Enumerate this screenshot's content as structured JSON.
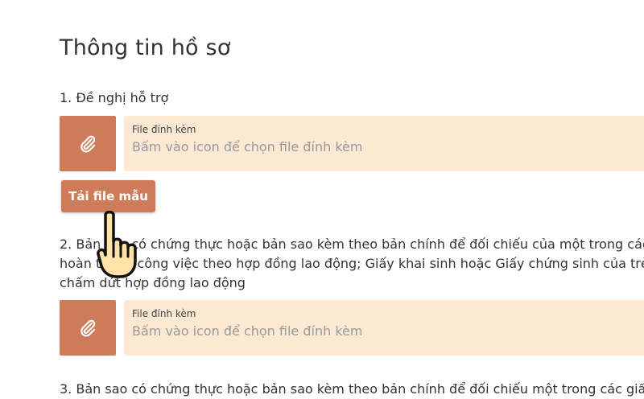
{
  "page": {
    "title": "Thông tin hồ sơ"
  },
  "sections": [
    {
      "label": "1. Đề nghị hỗ trợ",
      "attachment": {
        "label": "File đính kèm",
        "placeholder": "Bấm vào icon để chọn file đính kèm"
      },
      "sample_button": "Tải file mẫu"
    },
    {
      "label_lines": [
        "2. Bản sao có chứng thực hoặc bản sao kèm theo bản chính để đối chiếu của một trong các",
        "hoàn thành công việc theo hợp đồng lao động; Giấy khai sinh hoặc Giấy chứng sinh của trẻ",
        "chấm dứt hợp đồng lao động"
      ],
      "attachment": {
        "label": "File đính kèm",
        "placeholder": "Bấm vào icon để chọn file đính kèm"
      }
    },
    {
      "label": "3. Bản sao có chứng thực hoặc bản sao kèm theo bản chính để đối chiếu một trong các giấ"
    }
  ],
  "colors": {
    "accent": "#cd7b59",
    "field_bg": "#fbe9d3"
  },
  "icons": {
    "attach": "paperclip-icon",
    "cursor": "hand-pointer-icon"
  }
}
